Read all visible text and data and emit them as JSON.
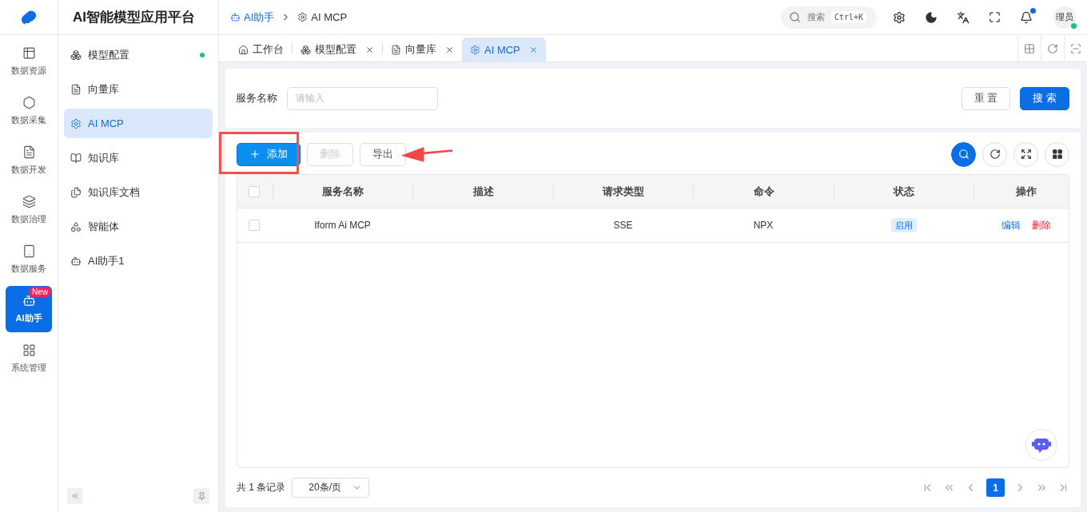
{
  "app_title": "AI智能模型应用平台",
  "rail": [
    {
      "label": "数据资源",
      "kind": "table",
      "selected": false
    },
    {
      "label": "数据采集",
      "kind": "hex",
      "selected": false
    },
    {
      "label": "数据开发",
      "kind": "doc",
      "selected": false
    },
    {
      "label": "数据治理",
      "kind": "layers",
      "selected": false
    },
    {
      "label": "数据服务",
      "kind": "tablet",
      "selected": false
    },
    {
      "label": "AI助手",
      "kind": "ai",
      "selected": true,
      "badge": "New"
    },
    {
      "label": "系统管理",
      "kind": "grid",
      "selected": false
    }
  ],
  "menu": [
    {
      "label": "模型配置",
      "kind": "cluster",
      "selected": false,
      "color": "#19c37d"
    },
    {
      "label": "向量库",
      "kind": "doc",
      "selected": false
    },
    {
      "label": "AI MCP",
      "kind": "gear",
      "selected": true
    },
    {
      "label": "知识库",
      "kind": "book",
      "selected": false
    },
    {
      "label": "知识库文档",
      "kind": "files",
      "selected": false
    },
    {
      "label": "智能体",
      "kind": "agent",
      "selected": false
    },
    {
      "label": "AI助手1",
      "kind": "ai",
      "selected": false
    }
  ],
  "breadcrumb": [
    {
      "label": "AI助手",
      "kind": "ai",
      "current": false
    },
    {
      "label": "AI MCP",
      "kind": "gear",
      "current": true
    }
  ],
  "header": {
    "search_placeholder": "搜索",
    "shortcut": "Ctrl+K",
    "avatar": "理员",
    "notification": true
  },
  "tabs": [
    {
      "label": "工作台",
      "kind": "home",
      "selected": false,
      "closable": false
    },
    {
      "label": "模型配置",
      "kind": "cluster",
      "selected": false,
      "closable": true
    },
    {
      "label": "向量库",
      "kind": "doc",
      "selected": false,
      "closable": true
    },
    {
      "label": "AI MCP",
      "kind": "gear",
      "selected": true,
      "closable": true
    }
  ],
  "filter": {
    "label": "服务名称",
    "placeholder": "请输入",
    "reset": "重 置",
    "search": "搜 索"
  },
  "toolbar": {
    "add": "添加",
    "delete": "删除",
    "export": "导出",
    "delete_disabled": true
  },
  "table": {
    "select_all": false,
    "columns": [
      "服务名称",
      "描述",
      "请求类型",
      "命令",
      "状态",
      "操作"
    ],
    "rows": [
      {
        "checked": false,
        "name": "Iform Ai MCP",
        "type": "SSE",
        "command": "NPX",
        "status": "启用",
        "edit": "编辑",
        "remove": "删除"
      }
    ]
  },
  "pagination": {
    "total": "共 1 条记录",
    "page_size": "20条/页",
    "pages": [
      {
        "label": "1",
        "selected": true
      }
    ]
  }
}
